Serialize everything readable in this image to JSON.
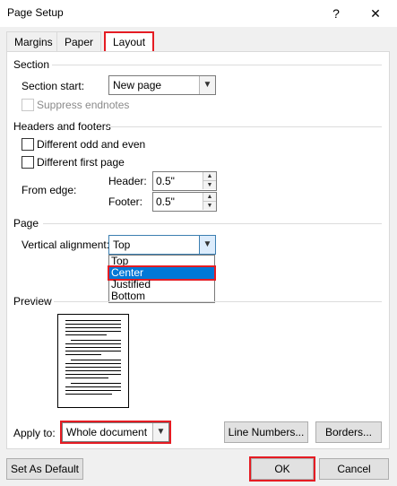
{
  "window": {
    "title": "Page Setup",
    "help_glyph": "?",
    "close_glyph": "✕"
  },
  "tabs": [
    "Margins",
    "Paper",
    "Layout"
  ],
  "section": {
    "heading": "Section",
    "section_start_label": "Section start:",
    "section_start_value": "New page",
    "suppress_endnotes_label": "Suppress endnotes"
  },
  "headers_footers": {
    "heading": "Headers and footers",
    "odd_even_label": "Different odd and even",
    "first_page_label": "Different first page",
    "from_edge_label": "From edge:",
    "header_label": "Header:",
    "header_value": "0.5\"",
    "footer_label": "Footer:",
    "footer_value": "0.5\""
  },
  "page": {
    "heading": "Page",
    "vertical_alignment_label": "Vertical alignment:",
    "vertical_alignment_value": "Top",
    "options": [
      "Top",
      "Center",
      "Justified",
      "Bottom"
    ]
  },
  "preview": {
    "heading": "Preview"
  },
  "apply": {
    "label": "Apply to:",
    "value": "Whole document",
    "line_numbers_label": "Line Numbers...",
    "borders_label": "Borders..."
  },
  "footer_buttons": {
    "set_default": "Set As Default",
    "ok": "OK",
    "cancel": "Cancel"
  },
  "colors": {
    "highlight": "#e51c23",
    "selection": "#0078d7"
  }
}
